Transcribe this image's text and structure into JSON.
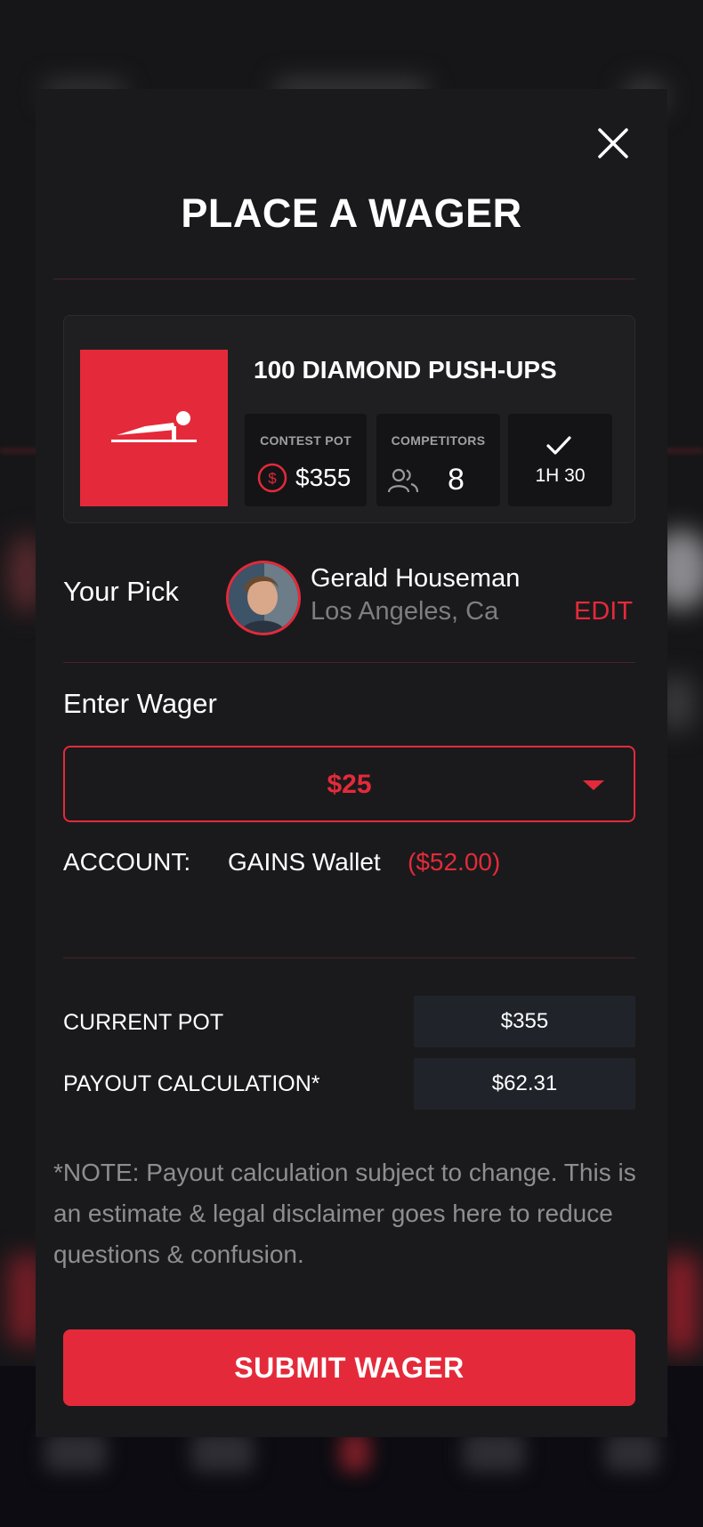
{
  "modal": {
    "title": "PLACE A WAGER"
  },
  "contest": {
    "title": "100 DIAMOND PUSH-UPS",
    "pot_label": "CONTEST POT",
    "pot_value": "$355",
    "competitors_label": "COMPETITORS",
    "competitors_value": "8",
    "time_value": "1H 30"
  },
  "pick": {
    "label": "Your Pick",
    "name": "Gerald Houseman",
    "location": "Los Angeles, Ca",
    "edit_label": "EDIT"
  },
  "wager": {
    "label": "Enter Wager",
    "selected": "$25",
    "account_label": "ACCOUNT:",
    "account_name": "GAINS Wallet",
    "account_balance": "($52.00)"
  },
  "summary": {
    "current_pot_label": "CURRENT POT",
    "current_pot_value": "$355",
    "payout_label": "PAYOUT CALCULATION*",
    "payout_value": "$62.31"
  },
  "note": "*NOTE: Payout calculation subject to change. This is an estimate & legal disclaimer goes here to reduce questions & confusion.",
  "submit_label": "SUBMIT WAGER",
  "colors": {
    "accent": "#e42a3a",
    "background": "#1a1a1c",
    "muted": "#7e7e82"
  },
  "icons": [
    "close-icon",
    "push-up-icon",
    "dollar-coin-icon",
    "users-icon",
    "check-icon",
    "chevron-down-icon"
  ]
}
